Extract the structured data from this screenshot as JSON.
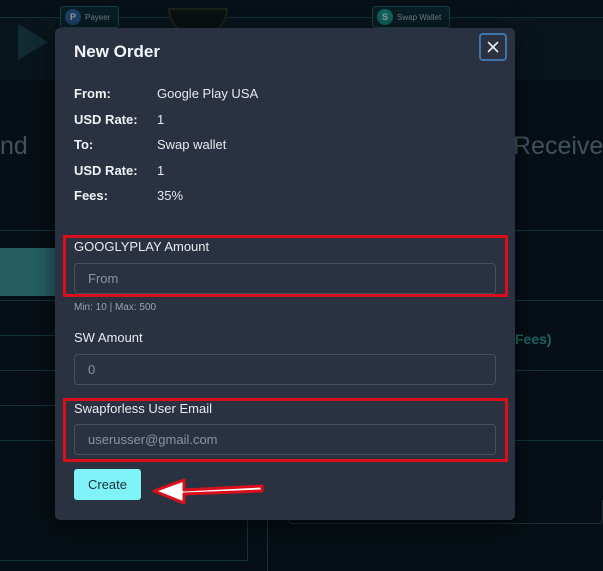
{
  "background": {
    "logos": [
      {
        "name": "Payeer"
      },
      {
        "name": "Swap Wallet"
      }
    ],
    "heading_left": "nd",
    "heading_right": "Receive",
    "fees_text": "Fees)"
  },
  "modal": {
    "title": "New Order",
    "close_icon": "close-icon",
    "info": [
      {
        "label": "From:",
        "value": "Google Play USA"
      },
      {
        "label": "USD Rate:",
        "value": "1"
      },
      {
        "label": "To:",
        "value": "Swap wallet"
      },
      {
        "label": "USD Rate:",
        "value": "1"
      },
      {
        "label": "Fees:",
        "value": "35%"
      }
    ],
    "amount_field": {
      "label": "GOOGLYPLAY Amount",
      "value": "",
      "placeholder": "From",
      "hint": "Min: 10 | Max: 500"
    },
    "sw_field": {
      "label": "SW Amount",
      "value": "",
      "placeholder": "0"
    },
    "email_field": {
      "label": "Swapforless User Email",
      "value": "",
      "placeholder": "userusser@gmail.com"
    },
    "create_label": "Create"
  },
  "colors": {
    "accent_button": "#7ff3f7",
    "modal_bg": "#2a3241",
    "annotation_red": "#d9101a"
  }
}
